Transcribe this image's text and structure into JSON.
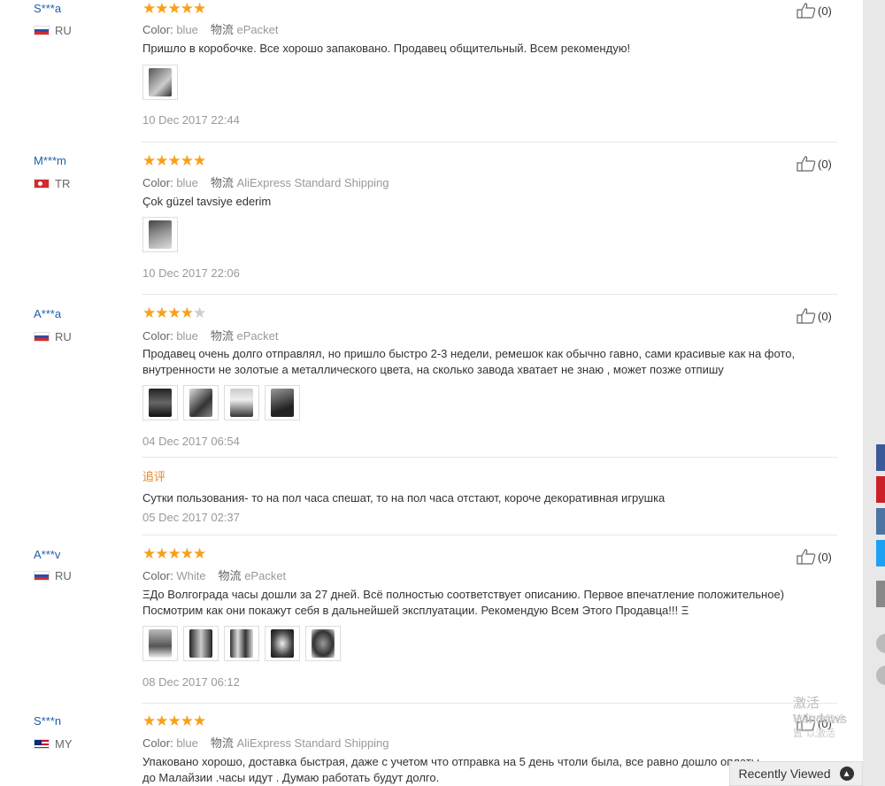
{
  "reviews": [
    {
      "user": "S***a",
      "country": "RU",
      "flag": "ru",
      "stars": 5,
      "color_label": "Color:",
      "color": "blue",
      "ship_label": "物流",
      "shipping": "ePacket",
      "text": "Пришло в коробочке. Все хорошо запаковано. Продавец общительный. Всем рекомендую!",
      "date": "10 Dec 2017 22:44",
      "likes": "(0)"
    },
    {
      "user": "M***m",
      "country": "TR",
      "flag": "tr",
      "stars": 5,
      "color_label": "Color:",
      "color": "blue",
      "ship_label": "物流",
      "shipping": "AliExpress Standard Shipping",
      "text": "Çok güzel tavsiye ederim",
      "date": "10 Dec 2017 22:06",
      "likes": "(0)"
    },
    {
      "user": "A***a",
      "country": "RU",
      "flag": "ru",
      "stars": 4,
      "color_label": "Color:",
      "color": "blue",
      "ship_label": "物流",
      "shipping": "ePacket",
      "text": "Продавец очень долго отправлял, но пришло быстро 2-3 недели, ремешок как обычно гавно, сами красивые как на фото, внутренности не золотые а металлического цвета, на сколько завода хватает не знаю , может позже отпишу",
      "date": "04 Dec 2017 06:54",
      "likes": "(0)",
      "followup_label": "追评",
      "followup_text": "Сутки пользования- то на пол часа спешат, то на пол часа отстают, короче декоративная игрушка",
      "followup_date": "05 Dec 2017 02:37"
    },
    {
      "user": "A***v",
      "country": "RU",
      "flag": "ru",
      "stars": 5,
      "color_label": "Color:",
      "color": "White",
      "ship_label": "物流",
      "shipping": "ePacket",
      "text": "ΞДо Волгограда часы дошли за 27 дней. Всё полностью соответствует описанию. Первое впечатление положительное) Посмотрим как они покажут себя в дальнейшей эксплуатации. Рекомендую Всем Этого Продавца!!! Ξ",
      "date": "08 Dec 2017 06:12",
      "likes": "(0)"
    },
    {
      "user": "S***n",
      "country": "MY",
      "flag": "my",
      "stars": 5,
      "color_label": "Color:",
      "color": "blue",
      "ship_label": "物流",
      "shipping": "AliExpress Standard Shipping",
      "text": "Упаковано хорошо, доставка быстрая, даже с учетом что отправка на 5 день чтоли была, все равно дошло оплаты до Малайзии .часы идут . Думаю работать будут долго.",
      "likes": "(0)"
    }
  ],
  "recently_viewed": "Recently Viewed",
  "windows_watermark": "激活 Windows",
  "windows_watermark_sub": "转到\"电脑设置\"以激活"
}
